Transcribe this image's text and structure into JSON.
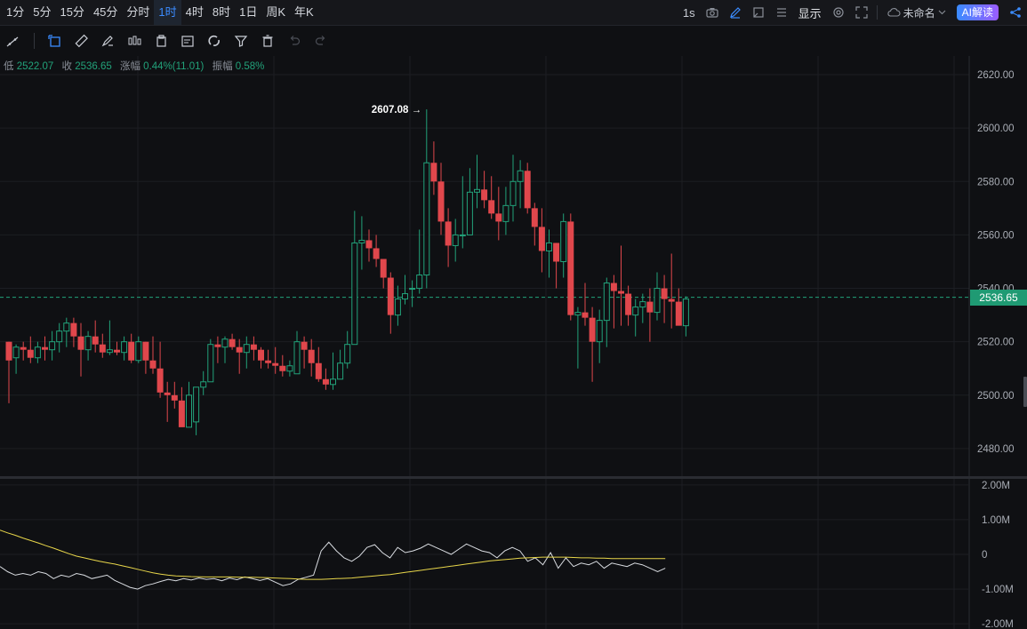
{
  "toolbar": {
    "intervals": [
      {
        "label": "1分",
        "active": false
      },
      {
        "label": "5分",
        "active": false
      },
      {
        "label": "15分",
        "active": false
      },
      {
        "label": "45分",
        "active": false
      },
      {
        "label": "分时",
        "active": false
      },
      {
        "label": "1时",
        "active": true
      },
      {
        "label": "4时",
        "active": false
      },
      {
        "label": "8时",
        "active": false
      },
      {
        "label": "1日",
        "active": false
      },
      {
        "label": "周K",
        "active": false
      },
      {
        "label": "年K",
        "active": false
      }
    ],
    "refresh": "1s",
    "display_label": "显示",
    "layout_name": "未命名",
    "ai_label": "AI解读"
  },
  "ohlc_bar": {
    "low_label": "低",
    "low_value": "2522.07",
    "close_label": "收",
    "close_value": "2536.65",
    "change_label": "涨幅",
    "change_value": "0.44%(11.01)",
    "amplitude_label": "振幅",
    "amplitude_value": "0.58%"
  },
  "colors": {
    "up": "#22a27a",
    "down": "#e0474c",
    "ma": "#e8d64a",
    "osc": "#d9dce1",
    "grid": "#1c1e23"
  },
  "chart_data": [
    {
      "type": "candlestick",
      "title": "",
      "y_range": [
        2470,
        2627
      ],
      "y_ticks": [
        "2620.00",
        "2600.00",
        "2580.00",
        "2560.00",
        "2540.00",
        "2520.00",
        "2500.00",
        "2480.00"
      ],
      "last_price": "2536.65",
      "high_marker": {
        "label": "2607.08",
        "index": 58
      },
      "candles": [
        [
          2520,
          2520,
          2497,
          2513
        ],
        [
          2514,
          2519,
          2508,
          2518
        ],
        [
          2518,
          2520,
          2513,
          2517
        ],
        [
          2517,
          2522,
          2512,
          2514
        ],
        [
          2514,
          2520,
          2512,
          2518
        ],
        [
          2518,
          2522,
          2513,
          2517
        ],
        [
          2517,
          2524,
          2513,
          2520
        ],
        [
          2520,
          2527,
          2516,
          2524
        ],
        [
          2524,
          2529,
          2518,
          2527
        ],
        [
          2527,
          2529,
          2518,
          2522
        ],
        [
          2522,
          2527,
          2507,
          2517
        ],
        [
          2517,
          2524,
          2513,
          2522
        ],
        [
          2522,
          2528,
          2516,
          2519
        ],
        [
          2519,
          2523,
          2514,
          2516
        ],
        [
          2516,
          2528,
          2515,
          2517
        ],
        [
          2517,
          2520,
          2515,
          2516
        ],
        [
          2516,
          2522,
          2513,
          2520
        ],
        [
          2520,
          2523,
          2512,
          2513
        ],
        [
          2513,
          2522,
          2512,
          2520
        ],
        [
          2520,
          2520,
          2508,
          2513
        ],
        [
          2513,
          2522,
          2508,
          2510
        ],
        [
          2510,
          2520,
          2499,
          2501
        ],
        [
          2501,
          2505,
          2490,
          2500
        ],
        [
          2500,
          2505,
          2495,
          2498
        ],
        [
          2498,
          2503,
          2490,
          2488
        ],
        [
          2488,
          2505,
          2488,
          2500
        ],
        [
          2490,
          2502,
          2485,
          2503
        ],
        [
          2503,
          2509,
          2500,
          2505
        ],
        [
          2505,
          2521,
          2505,
          2519
        ],
        [
          2519,
          2522,
          2512,
          2518
        ],
        [
          2518,
          2522,
          2512,
          2521
        ],
        [
          2521,
          2523,
          2517,
          2518
        ],
        [
          2518,
          2521,
          2508,
          2516
        ],
        [
          2516,
          2522,
          2510,
          2519
        ],
        [
          2519,
          2522,
          2513,
          2517
        ],
        [
          2517,
          2518,
          2510,
          2513
        ],
        [
          2513,
          2517,
          2510,
          2512
        ],
        [
          2512,
          2518,
          2508,
          2511
        ],
        [
          2511,
          2515,
          2507,
          2509
        ],
        [
          2509,
          2513,
          2507,
          2511
        ],
        [
          2508,
          2524,
          2508,
          2520
        ],
        [
          2520,
          2522,
          2510,
          2517
        ],
        [
          2517,
          2521,
          2507,
          2512
        ],
        [
          2512,
          2518,
          2505,
          2506
        ],
        [
          2506,
          2510,
          2502,
          2504
        ],
        [
          2504,
          2516,
          2502,
          2506
        ],
        [
          2506,
          2517,
          2506,
          2512
        ],
        [
          2512,
          2524,
          2510,
          2519
        ],
        [
          2519,
          2569,
          2519,
          2557
        ],
        [
          2557,
          2567,
          2547,
          2558
        ],
        [
          2558,
          2562,
          2550,
          2555
        ],
        [
          2555,
          2560,
          2548,
          2551
        ],
        [
          2551,
          2550,
          2540,
          2544
        ],
        [
          2544,
          2546,
          2523,
          2530
        ],
        [
          2530,
          2541,
          2526,
          2536
        ],
        [
          2536,
          2545,
          2534,
          2538
        ],
        [
          2540,
          2543,
          2533,
          2540
        ],
        [
          2540,
          2562,
          2538,
          2545
        ],
        [
          2545,
          2607,
          2540,
          2587
        ],
        [
          2587,
          2595,
          2575,
          2580
        ],
        [
          2580,
          2587,
          2560,
          2565
        ],
        [
          2565,
          2570,
          2548,
          2556
        ],
        [
          2556,
          2566,
          2550,
          2560
        ],
        [
          2560,
          2582,
          2555,
          2560
        ],
        [
          2560,
          2585,
          2560,
          2576
        ],
        [
          2576,
          2590,
          2570,
          2577
        ],
        [
          2577,
          2584,
          2570,
          2573
        ],
        [
          2573,
          2582,
          2566,
          2568
        ],
        [
          2568,
          2578,
          2558,
          2565
        ],
        [
          2565,
          2578,
          2560,
          2571
        ],
        [
          2571,
          2590,
          2565,
          2580
        ],
        [
          2580,
          2588,
          2570,
          2584
        ],
        [
          2584,
          2587,
          2568,
          2570
        ],
        [
          2570,
          2572,
          2556,
          2563
        ],
        [
          2563,
          2570,
          2546,
          2554
        ],
        [
          2554,
          2562,
          2544,
          2557
        ],
        [
          2557,
          2557,
          2540,
          2550
        ],
        [
          2550,
          2568,
          2544,
          2565
        ],
        [
          2565,
          2568,
          2528,
          2530
        ],
        [
          2530,
          2533,
          2510,
          2531
        ],
        [
          2531,
          2542,
          2526,
          2529
        ],
        [
          2529,
          2533,
          2505,
          2520
        ],
        [
          2520,
          2532,
          2512,
          2528
        ],
        [
          2528,
          2544,
          2518,
          2542
        ],
        [
          2542,
          2545,
          2525,
          2539
        ],
        [
          2539,
          2556,
          2526,
          2538
        ],
        [
          2538,
          2541,
          2526,
          2530
        ],
        [
          2530,
          2536,
          2522,
          2533
        ],
        [
          2533,
          2538,
          2527,
          2535
        ],
        [
          2535,
          2540,
          2520,
          2531
        ],
        [
          2531,
          2546,
          2528,
          2540
        ],
        [
          2540,
          2545,
          2527,
          2536
        ],
        [
          2536,
          2553,
          2525,
          2535
        ],
        [
          2535,
          2540,
          2527,
          2526
        ],
        [
          2526,
          2537,
          2522,
          2536
        ]
      ]
    },
    {
      "type": "line",
      "title": "",
      "y_ticks": [
        "2.00M",
        "1.00M",
        "0",
        "-1.00M",
        "-2.00M"
      ],
      "y_range": [
        -2.15,
        2.15
      ],
      "series": [
        {
          "values": [
            -0.35,
            -0.5,
            -0.6,
            -0.55,
            -0.6,
            -0.5,
            -0.55,
            -0.7,
            -0.6,
            -0.65,
            -0.55,
            -0.6,
            -0.7,
            -0.65,
            -0.6,
            -0.75,
            -0.85,
            -0.95,
            -1.0,
            -0.9,
            -0.85,
            -0.78,
            -0.72,
            -0.76,
            -0.7,
            -0.74,
            -0.68,
            -0.72,
            -0.7,
            -0.76,
            -0.68,
            -0.73,
            -0.65,
            -0.7,
            -0.75,
            -0.7,
            -0.8,
            -0.9,
            -0.85,
            -0.72,
            -0.66,
            -0.6,
            0.1,
            0.35,
            0.1,
            -0.1,
            -0.2,
            -0.05,
            0.2,
            0.28,
            0.05,
            -0.1,
            0.2,
            0.05,
            0.1,
            0.18,
            0.3,
            0.2,
            0.1,
            0.0,
            0.15,
            0.3,
            0.2,
            0.1,
            0.05,
            -0.1,
            0.1,
            0.2,
            0.1,
            -0.2,
            -0.1,
            -0.3,
            0.05,
            -0.4,
            -0.1,
            -0.35,
            -0.25,
            -0.3,
            -0.2,
            -0.4,
            -0.25,
            -0.3,
            -0.35,
            -0.25,
            -0.3,
            -0.4,
            -0.5,
            -0.4
          ]
        },
        {
          "values": [
            0.7,
            0.62,
            0.55,
            0.47,
            0.4,
            0.33,
            0.25,
            0.18,
            0.1,
            0.02,
            -0.05,
            -0.1,
            -0.15,
            -0.2,
            -0.24,
            -0.28,
            -0.33,
            -0.38,
            -0.43,
            -0.48,
            -0.53,
            -0.57,
            -0.6,
            -0.62,
            -0.63,
            -0.64,
            -0.645,
            -0.65,
            -0.65,
            -0.65,
            -0.65,
            -0.655,
            -0.66,
            -0.66,
            -0.665,
            -0.67,
            -0.68,
            -0.69,
            -0.7,
            -0.71,
            -0.72,
            -0.72,
            -0.72,
            -0.71,
            -0.7,
            -0.69,
            -0.68,
            -0.66,
            -0.64,
            -0.62,
            -0.6,
            -0.58,
            -0.55,
            -0.52,
            -0.49,
            -0.46,
            -0.43,
            -0.4,
            -0.37,
            -0.34,
            -0.31,
            -0.28,
            -0.25,
            -0.22,
            -0.19,
            -0.17,
            -0.15,
            -0.13,
            -0.11,
            -0.1,
            -0.09,
            -0.08,
            -0.08,
            -0.08,
            -0.08,
            -0.09,
            -0.1,
            -0.1,
            -0.11,
            -0.11,
            -0.12,
            -0.12,
            -0.12,
            -0.12,
            -0.12,
            -0.12,
            -0.12,
            -0.12
          ]
        }
      ]
    }
  ]
}
